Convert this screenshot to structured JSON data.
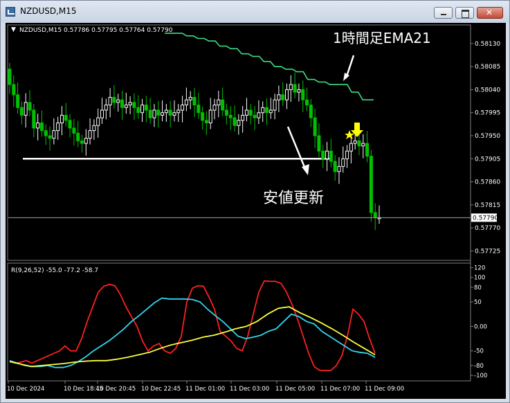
{
  "window": {
    "title": "NZDUSD,M15"
  },
  "chart_header": {
    "symbol_tf": "NZDUSD,M15",
    "ohlc": "0.57786 0.57795 0.57764 0.57790"
  },
  "price_axis": {
    "ticks": [
      "0.58130",
      "0.58085",
      "0.58040",
      "0.57995",
      "0.57950",
      "0.57905",
      "0.57860",
      "0.57815",
      "0.57770",
      "0.57725"
    ],
    "tick_values": [
      0.5813,
      0.58085,
      0.5804,
      0.57995,
      0.5795,
      0.57905,
      0.5786,
      0.57815,
      0.5777,
      0.57725
    ],
    "current_price": "0.57790"
  },
  "time_axis": {
    "labels": [
      "10 Dec 2024",
      "10 Dec 18:45",
      "10 Dec 20:45",
      "10 Dec 22:45",
      "11 Dec 01:00",
      "11 Dec 03:00",
      "11 Dec 05:00",
      "11 Dec 07:00",
      "11 Dec 09:00"
    ]
  },
  "annotations": {
    "ema_label": "1時間足EMA21",
    "low_label": "安値更新"
  },
  "oscillator": {
    "header": "R(9,26,52) -55.0 -77.2 -58.7",
    "ticks": [
      "120",
      "100",
      "80",
      "50",
      "0.00",
      "-50",
      "-80",
      "-100"
    ],
    "tick_values": [
      120,
      100,
      80,
      50,
      0,
      -50,
      -80,
      -100
    ]
  },
  "colors": {
    "bull_candle": "#ffffff",
    "bear_candle": "#00c000",
    "ema": "#3ddc84",
    "osc_red": "#ff2020",
    "osc_cyan": "#30d8f0",
    "osc_yellow": "#ffff40",
    "arrow_marker": "#ffff00"
  },
  "chart_data": [
    {
      "type": "candlestick",
      "title": "NZDUSD,M15",
      "ylim": [
        0.57708,
        0.58165
      ],
      "support_level": 0.57905,
      "series": [
        {
          "name": "price",
          "values": [
            0.5805,
            0.5803,
            0.58005,
            0.5799,
            0.58015,
            0.58,
            0.57965,
            0.57975,
            0.5796,
            0.5795,
            0.57945,
            0.5796,
            0.57975,
            0.5799,
            0.5798,
            0.57965,
            0.57955,
            0.5794,
            0.57935,
            0.57945,
            0.5796,
            0.5797,
            0.57985,
            0.58,
            0.5801,
            0.58025,
            0.58015,
            0.5802,
            0.58005,
            0.5801,
            0.58015,
            0.58005,
            0.57995,
            0.5801,
            0.58,
            0.57985,
            0.58,
            0.5799,
            0.57995,
            0.58,
            0.5799,
            0.57995,
            0.58,
            0.5801,
            0.5802,
            0.58025,
            0.5801,
            0.57995,
            0.5798,
            0.57975,
            0.58,
            0.5801,
            0.5802,
            0.58,
            0.5799,
            0.57985,
            0.5797,
            0.5798,
            0.5799,
            0.58,
            0.5799,
            0.57985,
            0.57995,
            0.58005,
            0.57995,
            0.58,
            0.5802,
            0.5803,
            0.5802,
            0.5804,
            0.5805,
            0.58035,
            0.5804,
            0.5802,
            0.5801,
            0.57985,
            0.5795,
            0.5792,
            0.57905,
            0.5792,
            0.579,
            0.5788,
            0.5789,
            0.57905,
            0.5792,
            0.57935,
            0.5794,
            0.5793,
            0.57935,
            0.5791,
            0.578,
            0.5779,
            0.5779
          ]
        }
      ]
    },
    {
      "type": "line",
      "title": "1時間足EMA21",
      "series": [
        {
          "name": "1時間足EMA21",
          "values": [
            0.5815,
            0.5815,
            0.58145,
            0.5814,
            0.58135,
            0.58125,
            0.5812,
            0.5811,
            0.58105,
            0.58095,
            0.58085,
            0.5808,
            0.58075,
            0.5806,
            0.58055,
            0.5805,
            0.5805,
            0.58035,
            0.5802,
            0.5802
          ]
        }
      ]
    },
    {
      "type": "line",
      "title": "R(9,26,52)",
      "ylim": [
        -107,
        125
      ],
      "series": [
        {
          "name": "-55.0",
          "values": [
            -70,
            -75,
            -73,
            -70,
            -75,
            -70,
            -65,
            -60,
            -55,
            -50,
            -40,
            -50,
            -50,
            -25,
            10,
            40,
            70,
            82,
            86,
            83,
            65,
            40,
            20,
            0,
            -30,
            -50,
            -40,
            -35,
            -50,
            -55,
            -45,
            -20,
            50,
            78,
            83,
            82,
            60,
            35,
            -10,
            -20,
            -30,
            -45,
            -50,
            -20,
            25,
            70,
            93,
            92,
            92,
            88,
            70,
            45,
            15,
            -20,
            -55,
            -82,
            -90,
            -90,
            -90,
            -80,
            -60,
            -20,
            35,
            25,
            10,
            -25,
            -55
          ]
        },
        {
          "name": "-77.2",
          "values": [
            -70,
            -75,
            -80,
            -82,
            -82,
            -80,
            -84,
            -84,
            -80,
            -72,
            -62,
            -50,
            -40,
            -30,
            -18,
            -5,
            10,
            22,
            35,
            48,
            58,
            56,
            56,
            56,
            55,
            50,
            35,
            22,
            10,
            -5,
            -20,
            -25,
            -22,
            -18,
            -10,
            -5,
            10,
            25,
            20,
            10,
            5,
            -10,
            -20,
            -30,
            -40,
            -50,
            -53,
            -55,
            -63
          ]
        },
        {
          "name": "-58.7",
          "values": [
            -72,
            -77,
            -82,
            -80,
            -78,
            -76,
            -73,
            -71,
            -70,
            -70,
            -67,
            -63,
            -58,
            -53,
            -45,
            -38,
            -33,
            -28,
            -22,
            -18,
            -12,
            -5,
            0,
            10,
            25,
            37,
            40,
            28,
            18,
            7,
            -5,
            -18,
            -32,
            -45,
            -58
          ]
        }
      ]
    }
  ]
}
